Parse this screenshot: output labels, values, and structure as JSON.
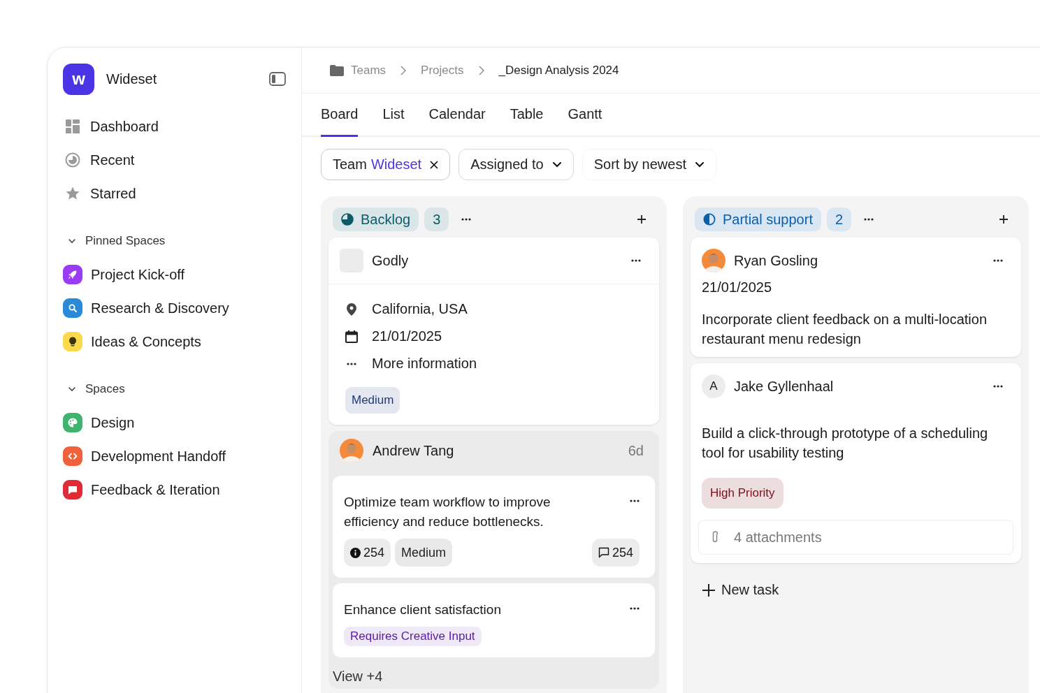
{
  "sidebar": {
    "logo_text": "w",
    "brand": "Wideset",
    "nav": [
      {
        "label": "Dashboard"
      },
      {
        "label": "Recent"
      },
      {
        "label": "Starred"
      }
    ],
    "sections": [
      {
        "title": "Pinned Spaces",
        "expanded": true,
        "items": [
          {
            "label": "Project Kick-off",
            "color": "#9b3cf5"
          },
          {
            "label": "Research & Discovery",
            "color": "#2a8ad8"
          },
          {
            "label": "Ideas & Concepts",
            "color": "#fcd94a"
          }
        ]
      },
      {
        "title": "Spaces",
        "expanded": true,
        "items": [
          {
            "label": "Design",
            "color": "#3fb46f"
          },
          {
            "label": "Development Handoff",
            "color": "#f0603a"
          },
          {
            "label": "Feedback & Iteration",
            "color": "#e02a35"
          }
        ]
      }
    ]
  },
  "breadcrumb": [
    {
      "label": "Teams",
      "current": false
    },
    {
      "label": "Projects",
      "current": false
    },
    {
      "label": "_Design Analysis 2024",
      "current": true
    }
  ],
  "tabs": [
    {
      "label": "Board",
      "selected": true
    },
    {
      "label": "List",
      "selected": false
    },
    {
      "label": "Calendar",
      "selected": false
    },
    {
      "label": "Table",
      "selected": false
    },
    {
      "label": "Gantt",
      "selected": false
    }
  ],
  "filters": [
    {
      "kind": "chip",
      "label": "Team",
      "value": "Wideset"
    },
    {
      "kind": "dropdown",
      "label": "Assigned to"
    },
    {
      "kind": "sort",
      "label": "Sort by newest"
    }
  ],
  "columns": [
    {
      "title": "Backlog",
      "count": "3",
      "color": "#0e5a66",
      "cards": [
        {
          "kind": "company",
          "name": "Godly",
          "details": [
            {
              "text": "California, USA"
            },
            {
              "text": "21/01/2025"
            },
            {
              "text": "More information"
            }
          ],
          "tags": [
            {
              "text": "Medium",
              "color": "#1c3b80"
            }
          ]
        },
        {
          "kind": "group",
          "name": "Andrew Tang",
          "age": "6d",
          "tasks": [
            {
              "title": "Optimize team workflow to improve efficiency and reduce bottlenecks.",
              "info_count": "254",
              "tags": [
                {
                  "text": "Medium",
                  "color": "#222222"
                }
              ],
              "comments": "254"
            },
            {
              "title": "Enhance client satisfaction",
              "tags": [
                {
                  "text": "Requires Creative Input",
                  "color": "#5b1aa8"
                }
              ]
            }
          ],
          "more": "View +4"
        }
      ]
    },
    {
      "title": "Partial support",
      "count": "2",
      "color": "#0b5ea8",
      "cards": [
        {
          "kind": "person",
          "name": "Ryan Gosling",
          "date": "21/01/2025",
          "description": "Incorporate client feedback on a multi-location restaurant menu redesign"
        },
        {
          "kind": "person",
          "name": "Jake Gyllenhaal",
          "avatar": {
            "kind": "initial",
            "text": "A"
          },
          "description": "Build a click-through prototype of a scheduling tool for usability testing",
          "tags": [
            {
              "text": "High Priority",
              "color": "#7a0f1a"
            }
          ],
          "attachments": "4 attachments"
        }
      ],
      "new_task": "New task"
    }
  ]
}
